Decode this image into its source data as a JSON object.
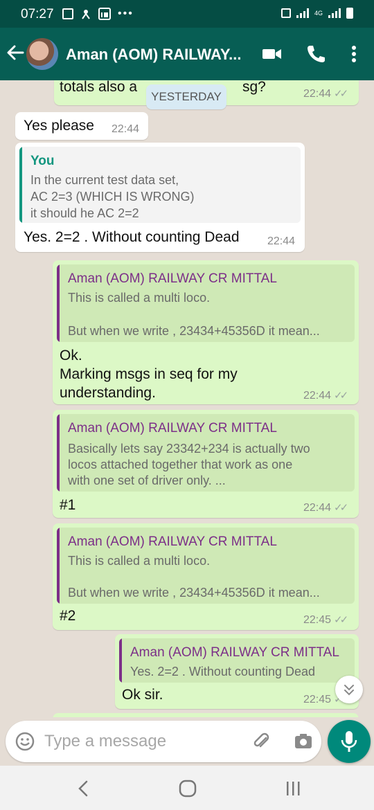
{
  "status_bar": {
    "time": "07:27",
    "network": "4G",
    "icons": [
      "gallery-icon",
      "notification-icon",
      "linkedin-icon",
      "more-dots-icon",
      "mute-icon",
      "signal-icon",
      "battery-icon"
    ]
  },
  "header": {
    "title": "Aman (AOM) RAILWAY...",
    "icons": [
      "back-arrow-icon",
      "avatar",
      "video-call-icon",
      "phone-icon",
      "overflow-menu-icon"
    ]
  },
  "date_divider": "YESTERDAY",
  "messages": [
    {
      "id": "m0",
      "direction": "out",
      "text_partial_left": "totals also a",
      "text_partial_right": "sg?",
      "time": "22:44",
      "status": "read"
    },
    {
      "id": "m1",
      "direction": "in",
      "text": "Yes please",
      "time": "22:44"
    },
    {
      "id": "m2",
      "direction": "in",
      "quote": {
        "author": "You",
        "lines": [
          "In the current test data set,",
          "AC 2=3 (WHICH IS WRONG)",
          "it should he AC 2=2"
        ]
      },
      "text": "Yes. 2=2 . Without counting Dead",
      "time": "22:44"
    },
    {
      "id": "m3",
      "direction": "out",
      "quote": {
        "author": "Aman (AOM) RAILWAY CR MITTAL",
        "lines": [
          "This is called a multi loco.",
          "",
          "But when we write , 23434+45356D it mean..."
        ]
      },
      "lines": [
        "Ok.",
        "Marking msgs in seq for my",
        "understanding."
      ],
      "time": "22:44",
      "status": "read"
    },
    {
      "id": "m4",
      "direction": "out",
      "quote": {
        "author": "Aman (AOM) RAILWAY CR MITTAL",
        "lines": [
          "Basically lets say 23342+234 is actually two",
          "locos attached together that work as one",
          "with one set of driver only. ..."
        ]
      },
      "text": "#1",
      "time": "22:44",
      "status": "read"
    },
    {
      "id": "m5",
      "direction": "out",
      "quote": {
        "author": "Aman (AOM) RAILWAY CR MITTAL",
        "lines": [
          "This is called a multi loco.",
          "",
          "But when we write , 23434+45356D it mean..."
        ]
      },
      "text": "#2",
      "time": "22:45",
      "status": "read"
    },
    {
      "id": "m6",
      "direction": "out",
      "quote": {
        "author": "Aman (AOM) RAILWAY CR MITTAL",
        "lines": [
          "Yes. 2=2 . Without counting Dead"
        ]
      },
      "text": "Ok sir.",
      "time": "22:45",
      "status": "read"
    }
  ],
  "composer": {
    "placeholder": "Type a message"
  },
  "colors": {
    "header": "#075e54",
    "status_bar": "#054d44",
    "out_bubble": "#dcf8c6",
    "in_bubble": "#ffffff",
    "quote_you": "#13967f",
    "quote_contact": "#7c2f88",
    "mic": "#00897b",
    "chat_bg": "#e5ddd5"
  },
  "nav_icons": [
    "recent-apps-icon",
    "home-icon",
    "back-icon"
  ]
}
